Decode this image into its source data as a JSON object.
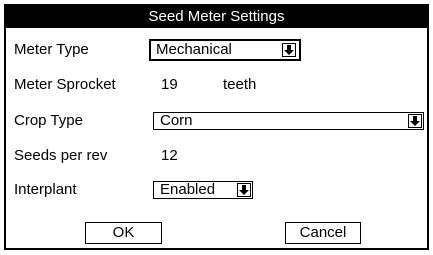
{
  "dialog": {
    "title": "Seed Meter Settings",
    "fields": {
      "meter_type": {
        "label": "Meter Type",
        "value": "Mechanical"
      },
      "meter_sprocket": {
        "label": "Meter Sprocket",
        "value": "19",
        "unit": "teeth"
      },
      "crop_type": {
        "label": "Crop Type",
        "value": "Corn"
      },
      "seeds_per_rev": {
        "label": "Seeds per rev",
        "value": "12"
      },
      "interplant": {
        "label": "Interplant",
        "value": "Enabled"
      }
    },
    "buttons": {
      "ok": "OK",
      "cancel": "Cancel"
    }
  },
  "icons": {
    "dropdown": "dropdown-arrow-icon"
  },
  "colors": {
    "titlebar_bg": "#000000",
    "titlebar_fg": "#ffffff",
    "background": "#ffffff"
  }
}
